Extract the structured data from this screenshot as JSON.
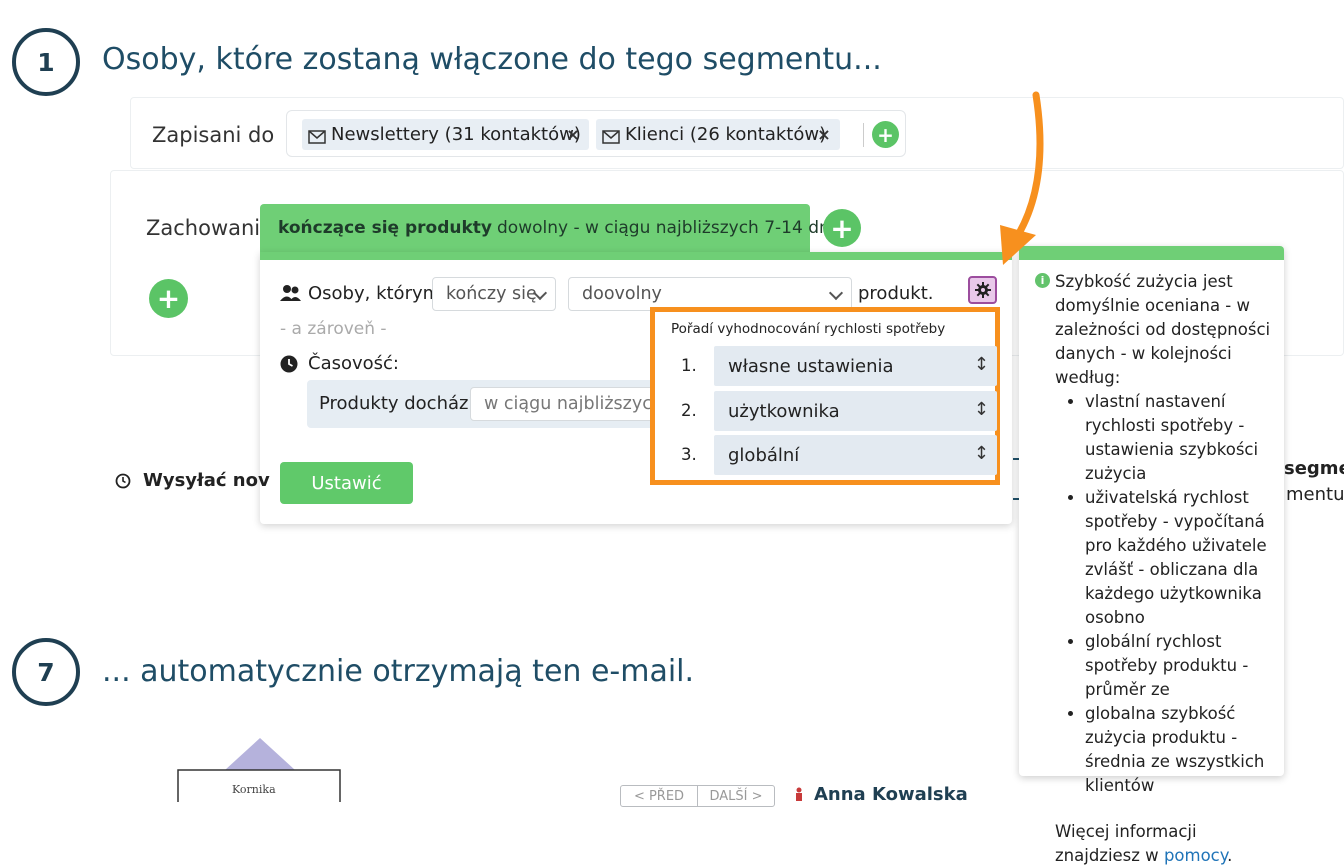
{
  "step1": {
    "number": "1",
    "title": "Osoby, które zostaną włączone do tego segmentu..."
  },
  "subscribed": {
    "label": "Zapisani do",
    "tags": [
      {
        "label": "Newslettery (31 kontaktów)",
        "remove": "×"
      },
      {
        "label": "Klienci (26 kontaktów)",
        "remove": "×"
      }
    ],
    "add_symbol": "+"
  },
  "behavior": {
    "label": "Zachowani",
    "add_symbol": "+",
    "tab_title_bold": "kończące się produkty",
    "tab_title_rest": "dowolny - w ciągu najbliższych 7-14 dni",
    "tab_add_symbol": "+"
  },
  "condition": {
    "people_label": "Osoby, którym",
    "verb_select": "kończy się",
    "product_select": "doovolny",
    "suffix": "produkt.",
    "and_label": "- a zároveň -",
    "timing_label": "Časovość:",
    "timing_row_label": "Produkty dochází",
    "timing_select": "w ciągu najbliższych",
    "submit_button": "Ustawić"
  },
  "order_popup": {
    "title": "Pořadí vyhodnocování rychlosti spotřeby",
    "items": [
      {
        "num": "1.",
        "label": "własne ustawienia",
        "handle": "↕"
      },
      {
        "num": "2.",
        "label": "użytkownika",
        "handle": "↕"
      },
      {
        "num": "3.",
        "label": "globální",
        "handle": "↕"
      }
    ]
  },
  "help": {
    "info_symbol": "i",
    "intro": "Szybkość zużycia jest domyślnie oceniana - w zależności od dostępności danych - w kolejności według:",
    "bullets": [
      "vlastní nastavení rychlosti spotřeby - ustawienia szybkości zużycia",
      "uživatelská rychlost spotřeby - vypočítaná pro každého uživatele zvlášť - obliczana dla każdego użytkownika osobno",
      "globální rychlost spotřeby produktu - průměr ze",
      "globalna szybkość zużycia produktu - średnia ze wszystkich klientów"
    ],
    "more_prefix": "Więcej informacji znajdziesz w",
    "more_link": "pomocy",
    "more_suffix": "."
  },
  "send": {
    "label": "Wysyłać nov"
  },
  "cut_right": {
    "line1": "segmer",
    "line2": "mentu:"
  },
  "step7": {
    "number": "7",
    "title": "... automatycznie otrzymają ten e-mail."
  },
  "preview": {
    "thumbnail_text": "Kornika",
    "prev": "< PŘED",
    "next": "DALŠÍ >",
    "recipient": "Anna Kowalska"
  },
  "colors": {
    "green": "#6fcf76",
    "orange": "#f7901e",
    "navy": "#1f3f52",
    "link": "#1f74b8"
  }
}
